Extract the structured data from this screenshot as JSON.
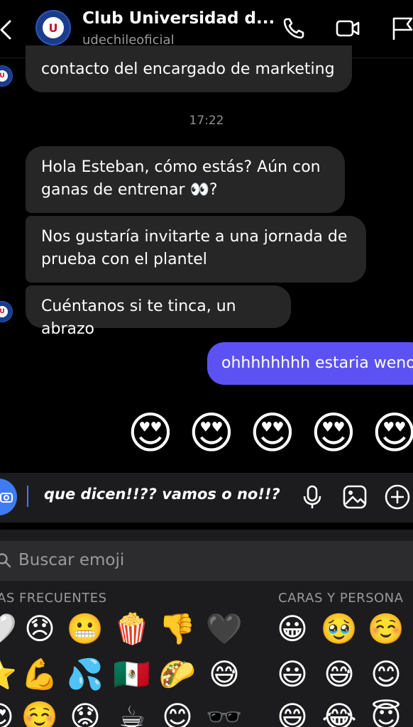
{
  "header": {
    "title": "Club Universidad d...",
    "username": "udechileoficial",
    "icons": [
      "back-arrow-icon",
      "phone-icon",
      "video-icon",
      "flag-icon"
    ]
  },
  "messages": {
    "partial": "contacto del encargado de marketing",
    "timestamp": "17:22",
    "m1_line1": "Hola Esteban, cómo estás? Aún con",
    "m1_line2": "ganas de entrenar 👀?",
    "m2_line1": "Nos gustaría invitarte a una jornada de",
    "m2_line2": "prueba con el plantel",
    "m3": "Cuéntanos si te tinca, un abrazo",
    "reply": "ohhhhhhhh estaria weno",
    "reaction_emojis": [
      "😍",
      "😍",
      "😍",
      "😍",
      "😍"
    ]
  },
  "composer": {
    "text": "que dicen!!?? vamos o no!!?",
    "icons": [
      "camera-icon",
      "microphone-icon",
      "image-icon",
      "plus-icon"
    ]
  },
  "keyboard": {
    "search_placeholder": "Buscar emoji",
    "category_frequent": "AS FRECUENTES",
    "category_faces": "CARAS Y PERSONA",
    "frequent": [
      [
        "🤍",
        "😞",
        "😬",
        "🍿",
        "👎",
        "🖤"
      ],
      [
        "⭐",
        "💪",
        "💦",
        "🇲🇽",
        "🌮",
        "😅"
      ],
      [
        "😍",
        "☺️",
        "😟",
        "☕",
        "😊",
        "🕶️"
      ]
    ],
    "faces": [
      [
        "😀",
        "🥹",
        "☺️"
      ],
      [
        "😃",
        "😅",
        "😊"
      ],
      [
        "😄",
        "😂",
        "😇"
      ]
    ]
  },
  "colors": {
    "background": "#000000",
    "incoming_bubble": "#262626",
    "outgoing_bubble": "#5c52f3",
    "keyboard": "#1c1c1e",
    "camera_button": "#3d7cf3"
  }
}
